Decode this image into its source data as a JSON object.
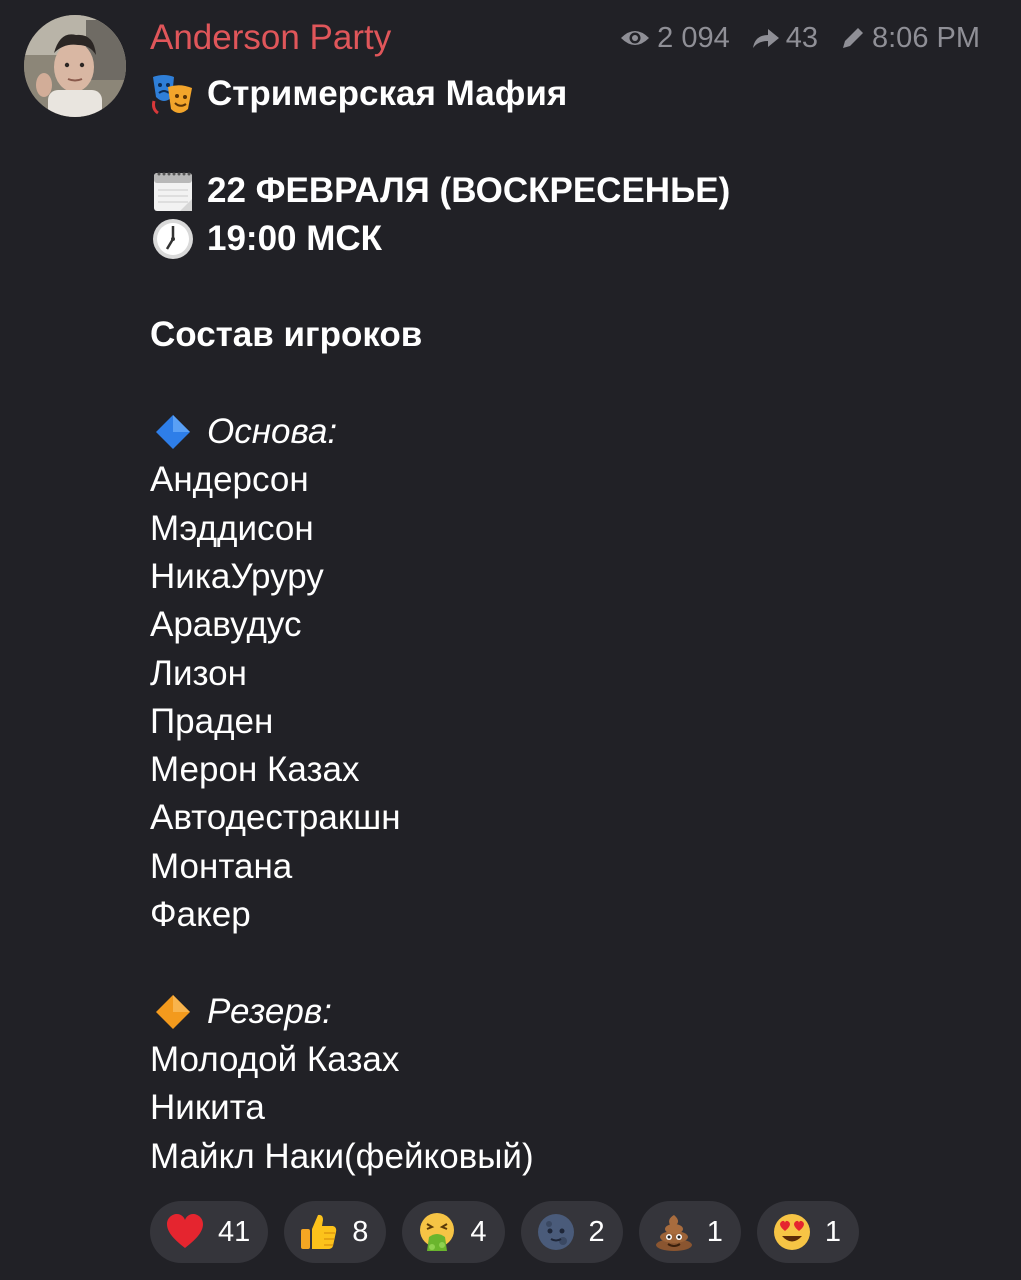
{
  "post": {
    "author": "Anderson Party",
    "views": "2 094",
    "forwards": "43",
    "time": "8:06 PM",
    "icons": {
      "views": "eye-icon",
      "forwards": "forward-arrow-icon",
      "edited": "pencil-icon"
    }
  },
  "message": {
    "title": "Стримерская Мафия",
    "title_icon": "performing-arts-masks-icon",
    "date": "22 ФЕВРАЛЯ (ВОСКРЕСЕНЬЕ)",
    "date_icon": "calendar-icon",
    "time": "19:00 МСК",
    "time_icon": "clock-icon",
    "players_heading": "Состав игроков",
    "main_label": "Основа:",
    "main_icon": "blue-diamond-icon",
    "main_players": [
      "Андерсон",
      "Мэддисон",
      "НикаУруру",
      "Аравудус",
      "Лизон",
      "Праден",
      "Мерон Казах",
      "Автодестракшн",
      "Монтана",
      "Факер"
    ],
    "reserve_label": "Резерв:",
    "reserve_icon": "orange-diamond-icon",
    "reserve_players": [
      "Молодой Казах",
      "Никита",
      "Майкл Наки(фейковый)"
    ]
  },
  "reactions": [
    {
      "icon": "red-heart-icon",
      "count": "41"
    },
    {
      "icon": "thumbs-up-icon",
      "count": "8"
    },
    {
      "icon": "vomiting-face-icon",
      "count": "4"
    },
    {
      "icon": "new-moon-face-icon",
      "count": "2"
    },
    {
      "icon": "pile-of-poo-icon",
      "count": "1"
    },
    {
      "icon": "heart-eyes-face-icon",
      "count": "1"
    }
  ],
  "colors": {
    "background": "#212126",
    "author": "#e0565a",
    "meta": "#8f8f96",
    "reaction_bg": "#35353b",
    "text": "#ffffff"
  }
}
